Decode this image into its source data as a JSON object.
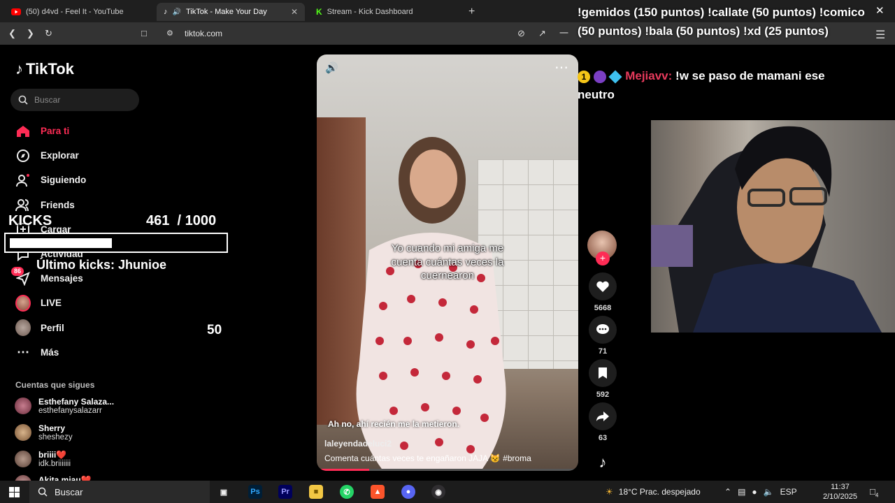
{
  "browser": {
    "tabs": [
      {
        "title": "(50) d4vd - Feel It - YouTube",
        "icon": "youtube-icon",
        "color": "#ff0000"
      },
      {
        "title": "TikTok - Make Your Day",
        "icon": "tiktok-icon",
        "color": "#ffffff"
      },
      {
        "title": "Stream - Kick Dashboard",
        "icon": "kick-icon",
        "color": "#53fc18"
      }
    ],
    "url": "tiktok.com"
  },
  "tiktok": {
    "logo": "TikTok",
    "search_placeholder": "Buscar",
    "nav": [
      {
        "label": "Para ti",
        "icon": "home-icon",
        "active": true
      },
      {
        "label": "Explorar",
        "icon": "compass-icon"
      },
      {
        "label": "Siguiendo",
        "icon": "following-icon"
      },
      {
        "label": "Friends",
        "icon": "friends-icon"
      },
      {
        "label": "Cargar",
        "icon": "upload-icon"
      },
      {
        "label": "Actividad",
        "icon": "activity-icon"
      },
      {
        "label": "Mensajes",
        "icon": "messages-icon",
        "badge": "86"
      },
      {
        "label": "LIVE",
        "icon": "live-icon"
      },
      {
        "label": "Perfil",
        "icon": "profile-icon"
      },
      {
        "label": "Más",
        "icon": "more-icon"
      }
    ],
    "following_title": "Cuentas que sigues",
    "following": [
      {
        "name": "Esthefany Salaza...",
        "handle": "esthefanysalazarr"
      },
      {
        "name": "Sherry",
        "handle": "sheshezy"
      },
      {
        "name": "briiii❤️",
        "handle": "idk.briiiiiii"
      },
      {
        "name": "Akita miau❤️",
        "handle": ""
      }
    ],
    "video": {
      "caption": "Yo cuando mi amiga me cuenta cuántas veces la cuernearon",
      "subcaption": "Ah no, ahí recién me la metieron.",
      "username": "laleyendadeluci2",
      "description": "Comenta cuántas veces te engañaron JAJA 😼 #broma",
      "progress": 0.19
    },
    "actions": [
      {
        "icon": "heart-icon",
        "count": "5668"
      },
      {
        "icon": "comment-icon",
        "count": "71"
      },
      {
        "icon": "bookmark-icon",
        "count": "592"
      },
      {
        "icon": "share-icon",
        "count": "63"
      }
    ]
  },
  "overlay": {
    "kicks_label": "KICKS",
    "kicks_count": "461",
    "kicks_goal": "/ 1000",
    "kicks_fraction": 0.461,
    "last_kicks": "Último kicks: Jhunioe",
    "number": "50"
  },
  "chat": {
    "commands": "!gemidos (150 puntos) !callate (50 puntos) !comico (50 puntos) !bala (50 puntos) !xd (25 puntos)",
    "message_user": "Mejiavv:",
    "message_text": "!w se paso de mamani ese neutro"
  },
  "taskbar": {
    "search_label": "Buscar",
    "weather": "18°C  Prac. despejado",
    "language": "ESP",
    "time": "11:37",
    "date": "2/10/2025",
    "notifications": "4"
  }
}
